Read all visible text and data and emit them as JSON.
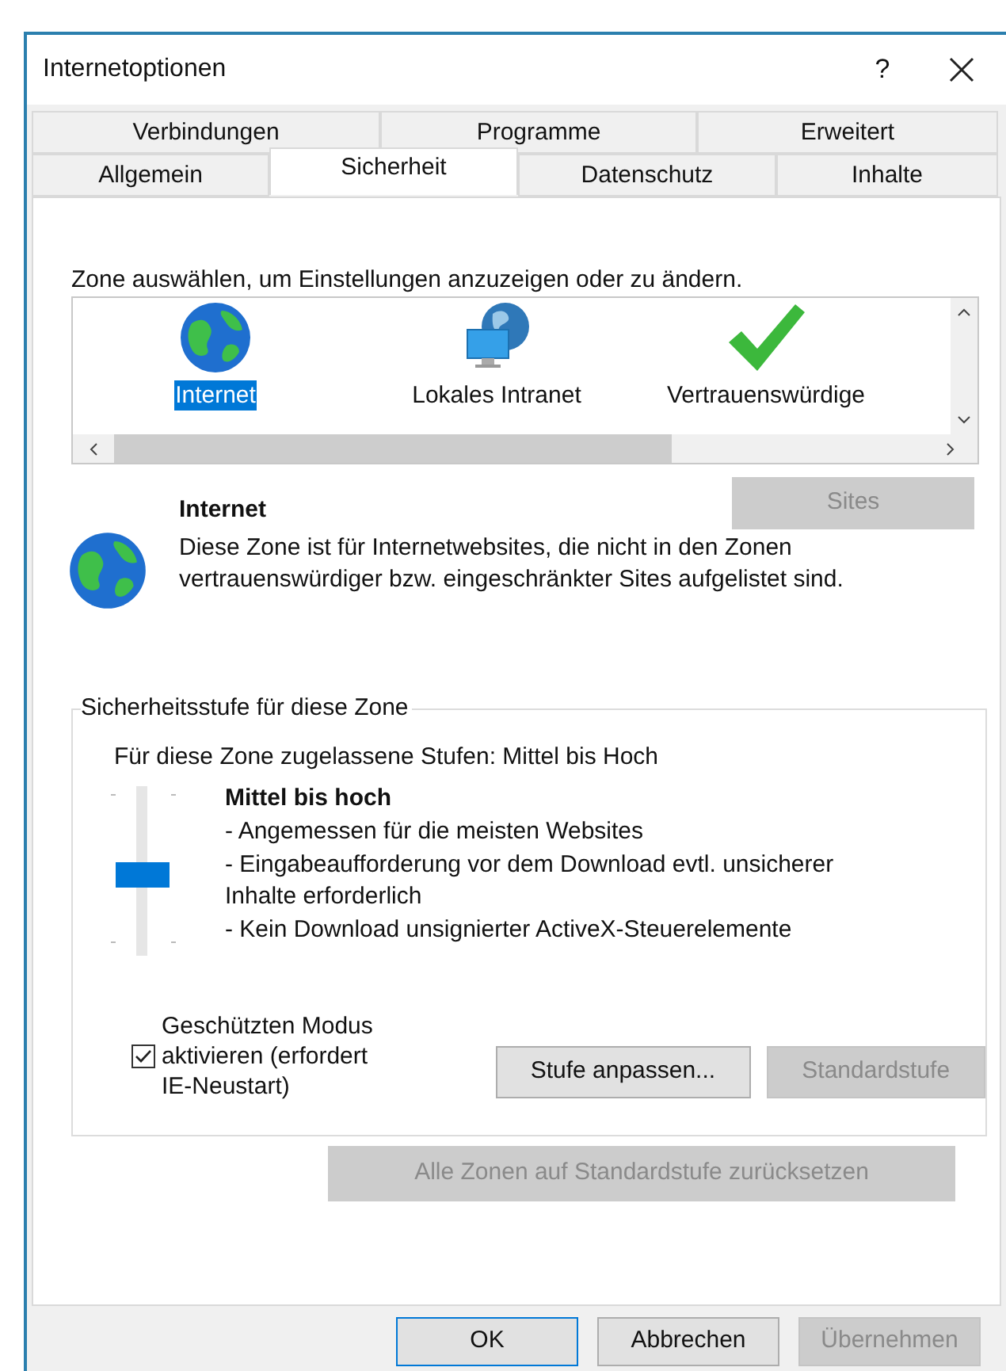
{
  "window": {
    "title": "Internetoptionen",
    "help": "?"
  },
  "tab_rows": [
    {
      "tabs": [
        {
          "label": "Verbindungen",
          "selected": false
        },
        {
          "label": "Programme",
          "selected": false
        },
        {
          "label": "Erweitert",
          "selected": false
        }
      ]
    },
    {
      "tabs": [
        {
          "label": "Allgemein",
          "selected": false
        },
        {
          "label": "Sicherheit",
          "selected": true
        },
        {
          "label": "Datenschutz",
          "selected": false
        },
        {
          "label": "Inhalte",
          "selected": false
        }
      ]
    }
  ],
  "zone_prompt": "Zone auswählen, um Einstellungen anzuzeigen oder zu ändern.",
  "zones": [
    {
      "kind": "globe",
      "label": "Internet",
      "selected": true
    },
    {
      "kind": "intranet",
      "label": "Lokales Intranet",
      "selected": false
    },
    {
      "kind": "check",
      "label": "Vertrauenswürdige",
      "selected": false
    }
  ],
  "zone_info": {
    "title": "Internet",
    "description": "Diese Zone ist für Internetwebsites, die nicht in den Zonen vertrauenswürdiger bzw. eingeschränkter Sites aufgelistet sind.",
    "sites_button": {
      "label": "Sites",
      "disabled": true
    }
  },
  "security_level": {
    "group_title": "Sicherheitsstufe für diese Zone",
    "allowed": "Für diese Zone zugelassene Stufen: Mittel bis Hoch",
    "slider": {
      "level": 0.5
    },
    "level_name": "Mittel bis hoch",
    "details": [
      "- Angemessen für die meisten Websites",
      "- Eingabeaufforderung vor dem Download evtl. unsicherer Inhalte erforderlich",
      "- Kein Download unsignierter ActiveX-Steuerelemente"
    ],
    "protected_mode": {
      "label": "Geschützten Modus aktivieren (erfordert IE-Neustart)",
      "checked": true
    },
    "buttons": [
      {
        "label": "Stufe anpassen...",
        "disabled": false
      },
      {
        "label": "Standardstufe",
        "disabled": true
      }
    ]
  },
  "reset_all": {
    "label": "Alle Zonen auf Standardstufe zurücksetzen",
    "disabled": true
  },
  "dialog_buttons": [
    {
      "label": "OK",
      "disabled": false,
      "default": true
    },
    {
      "label": "Abbrechen",
      "disabled": false,
      "default": false
    },
    {
      "label": "Übernehmen",
      "disabled": true,
      "default": false
    }
  ]
}
